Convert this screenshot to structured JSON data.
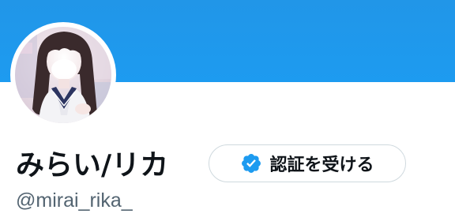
{
  "profile": {
    "display_name": "みらい/リカ",
    "handle": "@mirai_rika_",
    "verify_button_label": "認証を受ける"
  },
  "icons": {
    "verify": "verified-badge-icon"
  },
  "colors": {
    "banner": "#1d9bf0",
    "verified_badge": "#1d9bf0",
    "name_text": "#0f1419",
    "handle_text": "#536471",
    "button_border": "#cfd9de"
  }
}
